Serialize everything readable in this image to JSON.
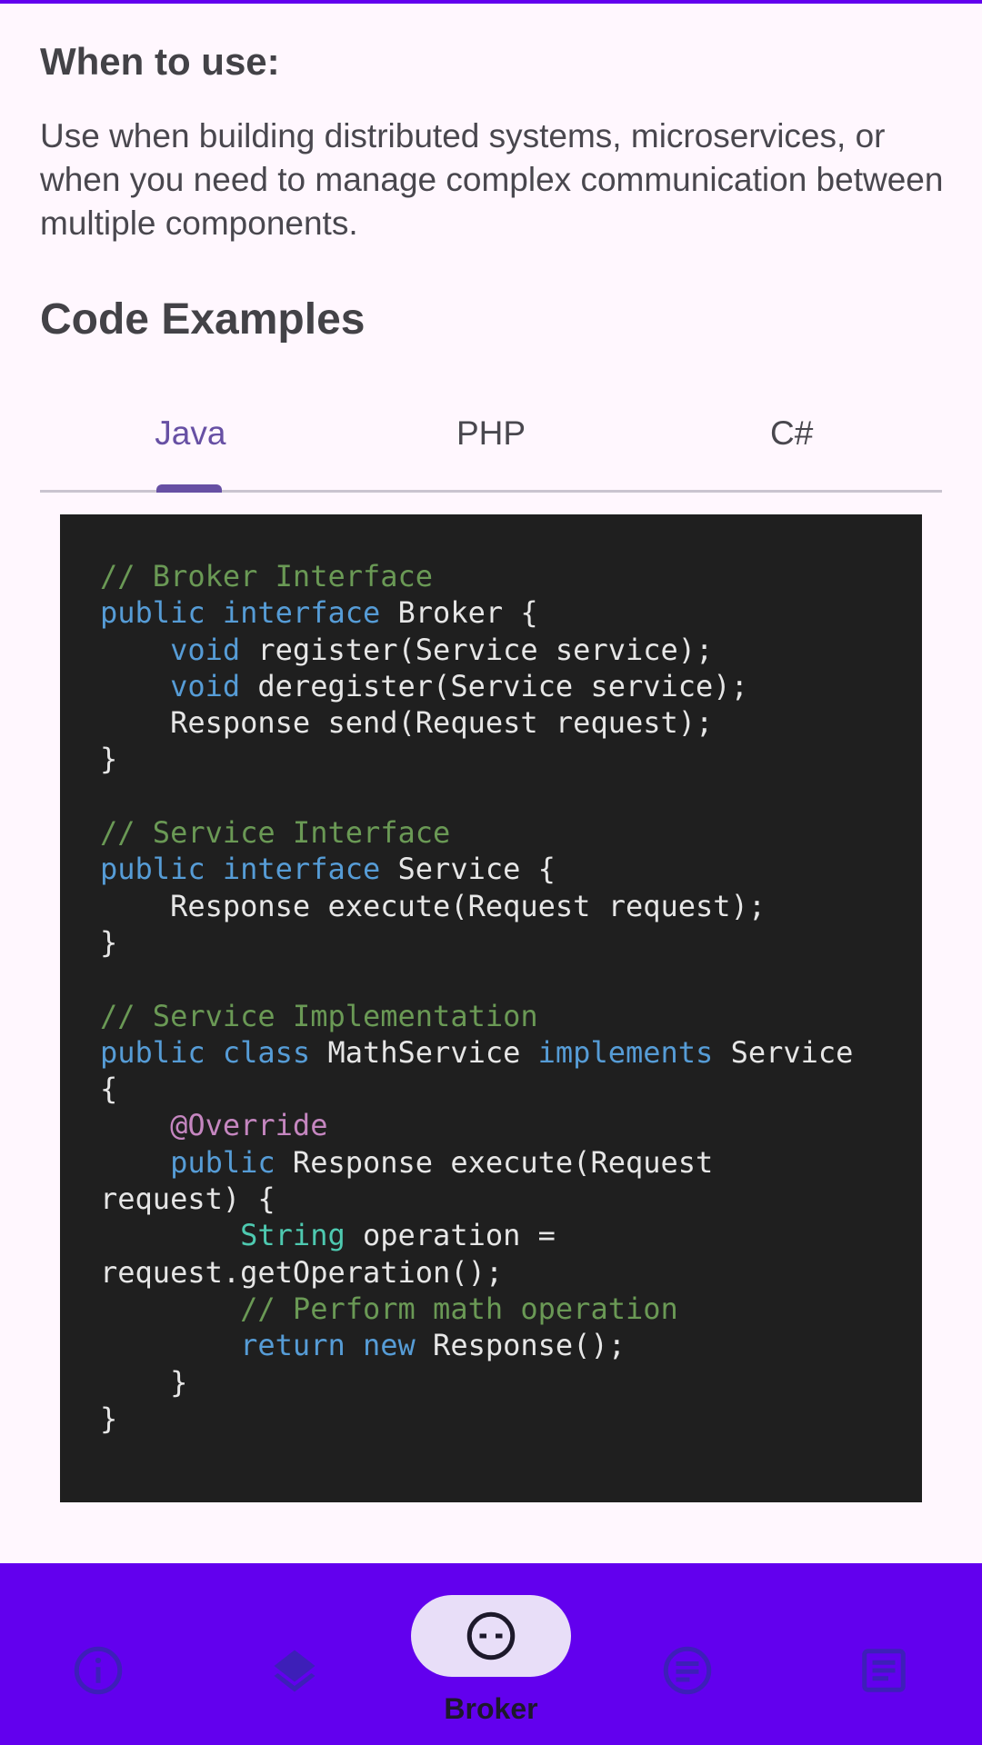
{
  "when_to_use": {
    "title": "When to use:",
    "body": "Use when building distributed systems, microservices, or when you need to manage complex communication between multiple components."
  },
  "code_examples": {
    "title": "Code Examples",
    "tabs": [
      {
        "label": "Java",
        "selected": true
      },
      {
        "label": "PHP",
        "selected": false
      },
      {
        "label": "C#",
        "selected": false
      }
    ],
    "code_lines": [
      [
        {
          "t": "// Broker Interface",
          "k": "comment"
        }
      ],
      [
        {
          "t": "public",
          "k": "keyword"
        },
        {
          "t": " ",
          "k": "plain"
        },
        {
          "t": "interface",
          "k": "keyword"
        },
        {
          "t": " Broker {",
          "k": "plain"
        }
      ],
      [
        {
          "t": "    ",
          "k": "plain"
        },
        {
          "t": "void",
          "k": "keyword"
        },
        {
          "t": " register(Service service);",
          "k": "plain"
        }
      ],
      [
        {
          "t": "    ",
          "k": "plain"
        },
        {
          "t": "void",
          "k": "keyword"
        },
        {
          "t": " deregister(Service service);",
          "k": "plain"
        }
      ],
      [
        {
          "t": "    Response send(Request request);",
          "k": "plain"
        }
      ],
      [
        {
          "t": "}",
          "k": "plain"
        }
      ],
      [
        {
          "t": "",
          "k": "plain"
        }
      ],
      [
        {
          "t": "// Service Interface",
          "k": "comment"
        }
      ],
      [
        {
          "t": "public",
          "k": "keyword"
        },
        {
          "t": " ",
          "k": "plain"
        },
        {
          "t": "interface",
          "k": "keyword"
        },
        {
          "t": " Service {",
          "k": "plain"
        }
      ],
      [
        {
          "t": "    Response execute(Request request);",
          "k": "plain"
        }
      ],
      [
        {
          "t": "}",
          "k": "plain"
        }
      ],
      [
        {
          "t": "",
          "k": "plain"
        }
      ],
      [
        {
          "t": "// Service Implementation",
          "k": "comment"
        }
      ],
      [
        {
          "t": "public",
          "k": "keyword"
        },
        {
          "t": " ",
          "k": "plain"
        },
        {
          "t": "class",
          "k": "keyword"
        },
        {
          "t": " MathService ",
          "k": "plain"
        },
        {
          "t": "implements",
          "k": "keyword"
        },
        {
          "t": " Service",
          "k": "plain"
        }
      ],
      [
        {
          "t": "{",
          "k": "plain"
        }
      ],
      [
        {
          "t": "    ",
          "k": "plain"
        },
        {
          "t": "@Override",
          "k": "annot"
        }
      ],
      [
        {
          "t": "    ",
          "k": "plain"
        },
        {
          "t": "public",
          "k": "keyword"
        },
        {
          "t": " Response execute(Request",
          "k": "plain"
        }
      ],
      [
        {
          "t": "request) {",
          "k": "plain"
        }
      ],
      [
        {
          "t": "        ",
          "k": "plain"
        },
        {
          "t": "String",
          "k": "type"
        },
        {
          "t": " operation =",
          "k": "plain"
        }
      ],
      [
        {
          "t": "request.getOperation();",
          "k": "plain"
        }
      ],
      [
        {
          "t": "        ",
          "k": "plain"
        },
        {
          "t": "// Perform math operation",
          "k": "comment"
        }
      ],
      [
        {
          "t": "        ",
          "k": "plain"
        },
        {
          "t": "return",
          "k": "keyword"
        },
        {
          "t": " ",
          "k": "plain"
        },
        {
          "t": "new",
          "k": "keyword"
        },
        {
          "t": " Response();",
          "k": "plain"
        }
      ],
      [
        {
          "t": "    }",
          "k": "plain"
        }
      ],
      [
        {
          "t": "}",
          "k": "plain"
        }
      ]
    ]
  },
  "bottom_nav": {
    "items": [
      {
        "icon": "info-icon",
        "label": "",
        "selected": false
      },
      {
        "icon": "layers-icon",
        "label": "",
        "selected": false
      },
      {
        "icon": "broker-face-icon",
        "label": "Broker",
        "selected": true
      },
      {
        "icon": "notes-icon",
        "label": "",
        "selected": false
      },
      {
        "icon": "article-icon",
        "label": "",
        "selected": false
      }
    ]
  },
  "colors": {
    "accent": "#6750A4",
    "nav_background": "#6200EE",
    "nav_icon": "#3D1FB8",
    "pill": "#E8DEF8",
    "code_background": "#1F1F1F",
    "code_comment": "#6A9955",
    "code_keyword": "#569CD6",
    "code_type": "#4EC9B0",
    "code_annotation": "#C586C0"
  }
}
